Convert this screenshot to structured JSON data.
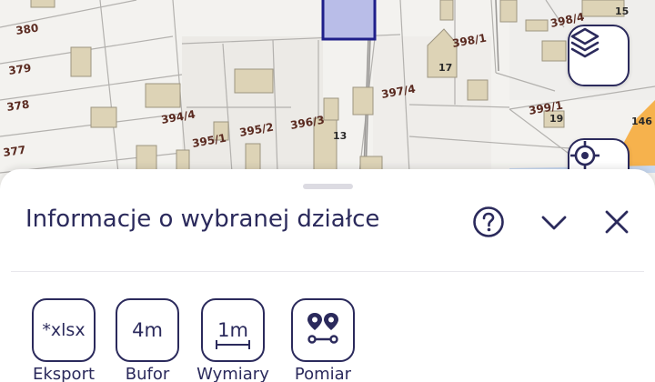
{
  "map": {
    "parcel_labels": [
      "380",
      "379",
      "378",
      "377",
      "394/4",
      "395/1",
      "395/2",
      "396/3",
      "397/4",
      "398/1",
      "398/4",
      "399/1"
    ],
    "building_labels": [
      "17",
      "13",
      "19",
      "146",
      "15"
    ],
    "colors": {
      "selected_fill": "#b9bde8",
      "selected_stroke": "#1f1f8a",
      "road": "#f6b24d"
    }
  },
  "map_controls": {
    "layers": {
      "icon": "layers-icon"
    },
    "locate": {
      "icon": "locate-icon"
    }
  },
  "sheet": {
    "title": "Informacje o wybranej działce",
    "help_icon": "help-icon",
    "collapse_icon": "chevron-down-icon",
    "close_icon": "close-icon",
    "tools": [
      {
        "label": "Eksport",
        "button_text": "*xlsx"
      },
      {
        "label": "Bufor",
        "button_text": "4m"
      },
      {
        "label": "Wymiary",
        "button_text": "1m"
      },
      {
        "label": "Pomiar",
        "icon": "route-pins-icon"
      }
    ]
  },
  "theme": {
    "primary": "#2b2a5c",
    "background": "#ffffff"
  }
}
